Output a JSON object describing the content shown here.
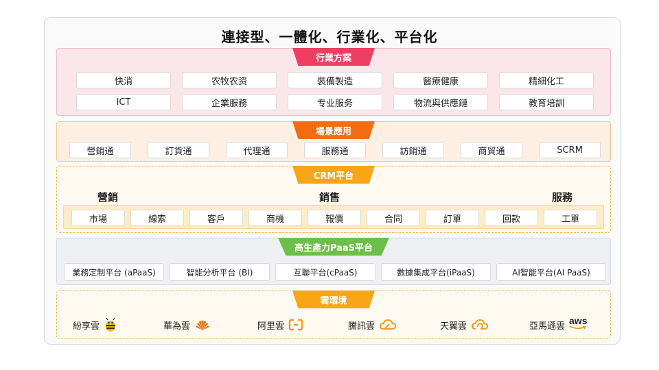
{
  "title": "連接型、一體化、行業化、平台化",
  "industry": {
    "banner": "行業方案",
    "row1": [
      "快消",
      "农牧农资",
      "裝備製造",
      "醫療健康",
      "精細化工"
    ],
    "row2": [
      "ICT",
      "企業服務",
      "专业服务",
      "物流與供應鏈",
      "教育培訓"
    ]
  },
  "scene": {
    "banner": "場景應用",
    "items": [
      "營銷通",
      "訂貨通",
      "代理通",
      "服務通",
      "訪銷通",
      "商貿通",
      "SCRM"
    ]
  },
  "crm": {
    "banner": "CRM平台",
    "groups": [
      "營銷",
      "銷售",
      "服務"
    ],
    "items": [
      "市場",
      "線索",
      "客戶",
      "商機",
      "報價",
      "合同",
      "訂單",
      "回款",
      "工單"
    ]
  },
  "paas": {
    "banner": "高生產力PaaS平台",
    "items": [
      "業務定制平台 (aPaaS)",
      "智能分析平台 (BI)",
      "互聯平台(cPaaS)",
      "數據集成平台(iPaaS)",
      "AI智能平台(AI PaaS)"
    ]
  },
  "cloud": {
    "banner": "雲環境",
    "items": [
      {
        "label": "紛享雲",
        "icon": "bee-logo-icon"
      },
      {
        "label": "華為雲",
        "icon": "huawei-logo-icon"
      },
      {
        "label": "阿里雲",
        "icon": "aliyun-logo-icon"
      },
      {
        "label": "騰訊雲",
        "icon": "tencent-cloud-logo-icon"
      },
      {
        "label": "天翼雲",
        "icon": "tianyi-cloud-logo-icon"
      },
      {
        "label": "亞馬遜雲",
        "icon": "aws-logo-icon"
      }
    ],
    "aws_text": "aws"
  },
  "colors": {
    "industry": "#ee3f63",
    "scene": "#f26d12",
    "crm": "#f8a518",
    "paas": "#6cc04a",
    "cloud": "#f8a518"
  }
}
